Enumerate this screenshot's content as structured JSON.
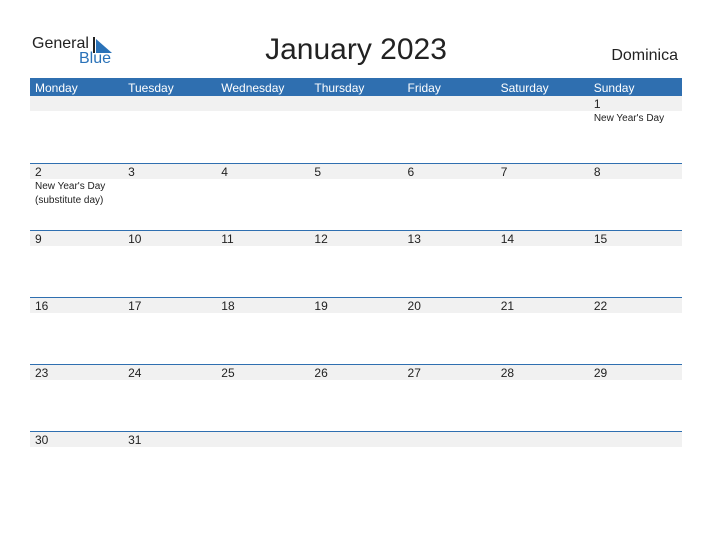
{
  "logo": {
    "general": "General",
    "blue": "Blue"
  },
  "title": "January 2023",
  "country": "Dominica",
  "weekdays": [
    "Monday",
    "Tuesday",
    "Wednesday",
    "Thursday",
    "Friday",
    "Saturday",
    "Sunday"
  ],
  "weeks": [
    [
      {
        "d": ""
      },
      {
        "d": ""
      },
      {
        "d": ""
      },
      {
        "d": ""
      },
      {
        "d": ""
      },
      {
        "d": ""
      },
      {
        "d": "1",
        "ev": "New Year's Day"
      }
    ],
    [
      {
        "d": "2",
        "ev": "New Year's Day\n(substitute day)"
      },
      {
        "d": "3"
      },
      {
        "d": "4"
      },
      {
        "d": "5"
      },
      {
        "d": "6"
      },
      {
        "d": "7"
      },
      {
        "d": "8"
      }
    ],
    [
      {
        "d": "9"
      },
      {
        "d": "10"
      },
      {
        "d": "11"
      },
      {
        "d": "12"
      },
      {
        "d": "13"
      },
      {
        "d": "14"
      },
      {
        "d": "15"
      }
    ],
    [
      {
        "d": "16"
      },
      {
        "d": "17"
      },
      {
        "d": "18"
      },
      {
        "d": "19"
      },
      {
        "d": "20"
      },
      {
        "d": "21"
      },
      {
        "d": "22"
      }
    ],
    [
      {
        "d": "23"
      },
      {
        "d": "24"
      },
      {
        "d": "25"
      },
      {
        "d": "26"
      },
      {
        "d": "27"
      },
      {
        "d": "28"
      },
      {
        "d": "29"
      }
    ],
    [
      {
        "d": "30"
      },
      {
        "d": "31"
      },
      {
        "d": ""
      },
      {
        "d": ""
      },
      {
        "d": ""
      },
      {
        "d": ""
      },
      {
        "d": ""
      }
    ]
  ],
  "colors": {
    "accent": "#2f6fb0",
    "band": "#f1f1f1"
  }
}
